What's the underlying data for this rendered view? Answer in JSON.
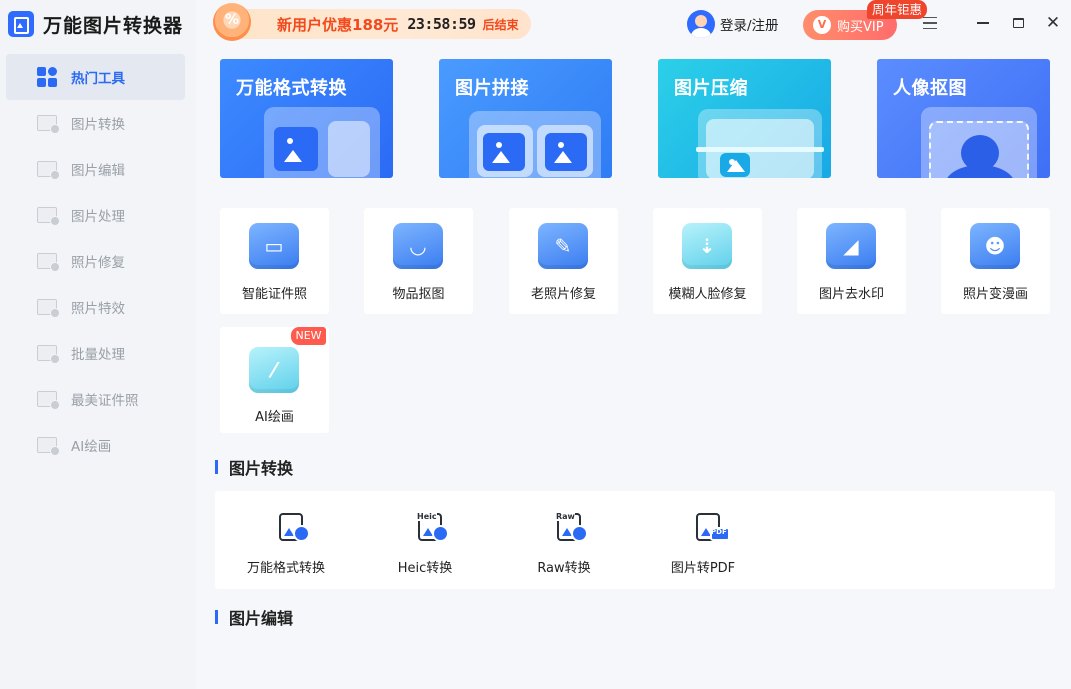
{
  "app": {
    "title": "万能图片转换器"
  },
  "sidebar": {
    "items": [
      {
        "label": "热门工具",
        "active": true
      },
      {
        "label": "图片转换"
      },
      {
        "label": "图片编辑"
      },
      {
        "label": "图片处理"
      },
      {
        "label": "照片修复"
      },
      {
        "label": "照片特效"
      },
      {
        "label": "批量处理"
      },
      {
        "label": "最美证件照"
      },
      {
        "label": "AI绘画"
      }
    ]
  },
  "topbar": {
    "promo_text": "新用户优惠188元",
    "promo_countdown": "23:58:59",
    "promo_suffix": "后结束",
    "login_label": "登录/注册",
    "vip_label": "购买VIP",
    "vip_badge": "周年钜惠"
  },
  "banners": [
    {
      "title": "万能格式转换"
    },
    {
      "title": "图片拼接"
    },
    {
      "title": "图片压缩"
    },
    {
      "title": "人像抠图"
    }
  ],
  "tools": [
    {
      "label": "智能证件照",
      "icon": "id-card-icon"
    },
    {
      "label": "物品抠图",
      "icon": "bag-icon"
    },
    {
      "label": "老照片修复",
      "icon": "wrench-photo-icon"
    },
    {
      "label": "模糊人脸修复",
      "icon": "face-restore-icon"
    },
    {
      "label": "图片去水印",
      "icon": "eraser-icon"
    },
    {
      "label": "照片变漫画",
      "icon": "cartoon-bear-icon"
    },
    {
      "label": "AI绘画",
      "icon": "ai-paint-icon",
      "badge": "NEW"
    }
  ],
  "sections": {
    "conversion_title": "图片转换",
    "edit_title": "图片编辑"
  },
  "conversion_tools": [
    {
      "label": "万能格式转换",
      "tag": ""
    },
    {
      "label": "Heic转换",
      "tag": "Heic"
    },
    {
      "label": "Raw转换",
      "tag": "Raw"
    },
    {
      "label": "图片转PDF",
      "tag": "PDF"
    }
  ],
  "colors": {
    "accent": "#2b6af5",
    "promo_red": "#f24a1d",
    "vip_gradient_start": "#ff8d6b",
    "vip_gradient_end": "#ff6c6c"
  }
}
